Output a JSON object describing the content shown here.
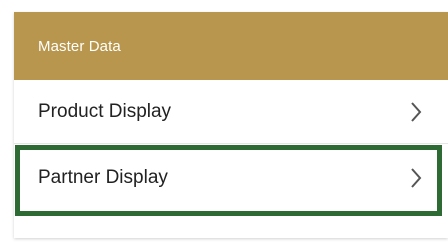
{
  "panel": {
    "title": "Master Data",
    "header_color": "#B8964D",
    "items": [
      {
        "label": "Product Display",
        "icon": "chevron-right-icon"
      },
      {
        "label": "Partner Display",
        "icon": "chevron-right-icon"
      }
    ]
  },
  "highlight": {
    "target": "Partner Display",
    "color": "#2E6A33"
  }
}
